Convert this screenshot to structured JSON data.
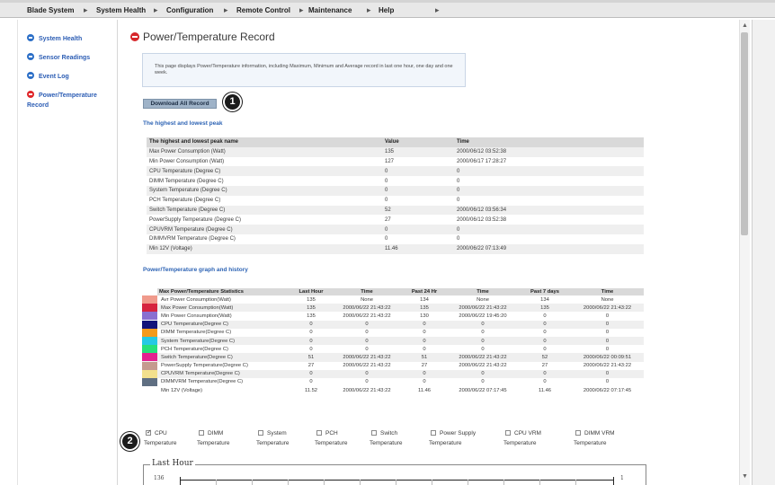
{
  "nav": {
    "items": [
      {
        "label": "Blade System",
        "x": 0
      },
      {
        "label": "System Health",
        "x": 0
      },
      {
        "label": "Configuration",
        "x": 0
      },
      {
        "label": "Remote Control",
        "x": 0
      },
      {
        "label": "Maintenance",
        "x": 0
      },
      {
        "label": "Help",
        "x": 0
      }
    ]
  },
  "sidebar": {
    "items": [
      {
        "label": "System Health"
      },
      {
        "label": "Sensor Readings"
      },
      {
        "label": "Event Log"
      },
      {
        "label": "Power/Temperature",
        "label_line2": "Record"
      }
    ]
  },
  "main": {
    "title": "Power/Temperature Record",
    "info_text": "This page displays Power/Temperature information, including Maximum, Minimum and Average record in last one hour, one day and one week.",
    "download_button": "Download All Record",
    "peak_section_title": "The highest and lowest peak",
    "peak_table": {
      "headers": [
        "The highest and lowest peak name",
        "Value",
        "Time"
      ],
      "rows": [
        [
          "Max Power Consumption (Watt)",
          "135",
          "2000/06/12 03:52:38"
        ],
        [
          "Min Power Consumption (Watt)",
          "127",
          "2000/06/17 17:28:27"
        ],
        [
          "CPU Temperature (Degree C)",
          "0",
          "0"
        ],
        [
          "DIMM Temperature (Degree C)",
          "0",
          "0"
        ],
        [
          "System Temperature (Degree C)",
          "0",
          "0"
        ],
        [
          "PCH Temperature (Degree C)",
          "0",
          "0"
        ],
        [
          "Switch Temperature (Degree C)",
          "52",
          "2000/06/12 03:56:34"
        ],
        [
          "PowerSupply Temperature (Degree C)",
          "27",
          "2000/06/12 03:52:38"
        ],
        [
          "CPUVRM Temperature (Degree C)",
          "0",
          "0"
        ],
        [
          "DIMMVRM Temperature (Degree C)",
          "0",
          "0"
        ],
        [
          "Min 12V (Voltage)",
          "11.46",
          "2000/06/22 07:13:49"
        ]
      ]
    },
    "graph_section_title": "Power/Temperature graph and history",
    "stats_table": {
      "headers": [
        "Max Power/Temperature Statistics",
        "Last Hour",
        "Time",
        "Past 24 Hr",
        "Time",
        "Past 7 days",
        "Time"
      ],
      "rows": [
        {
          "color": "#f09a8c",
          "cells": [
            "Avr Power Consumption(Watt)",
            "135",
            "None",
            "134",
            "None",
            "134",
            "None"
          ]
        },
        {
          "color": "#d6233f",
          "cells": [
            "Max Power Consumption(Watt)",
            "135",
            "2000/06/22 21:43:22",
            "135",
            "2000/06/22 21:43:22",
            "135",
            "2000/06/22 21:43:22"
          ]
        },
        {
          "color": "#8a6fd1",
          "cells": [
            "Min Power Consumption(Watt)",
            "135",
            "2000/06/22 21:43:22",
            "130",
            "2000/06/22 19:45:20",
            "0",
            "0"
          ]
        },
        {
          "color": "#13137a",
          "cells": [
            "CPU Temperature(Degree C)",
            "0",
            "0",
            "0",
            "0",
            "0",
            "0"
          ]
        },
        {
          "color": "#f49a1c",
          "cells": [
            "DIMM Temperature(Degree C)",
            "0",
            "0",
            "0",
            "0",
            "0",
            "0"
          ]
        },
        {
          "color": "#24c9e4",
          "cells": [
            "System Temperature(Degree C)",
            "0",
            "0",
            "0",
            "0",
            "0",
            "0"
          ]
        },
        {
          "color": "#26e07a",
          "cells": [
            "PCH Temperature(Degree C)",
            "0",
            "0",
            "0",
            "0",
            "0",
            "0"
          ]
        },
        {
          "color": "#e3228f",
          "cells": [
            "Switch Temperature(Degree C)",
            "51",
            "2000/06/22 21:43:22",
            "51",
            "2000/06/22 21:43:22",
            "52",
            "2000/06/22 00:09:51"
          ]
        },
        {
          "color": "#c59a8e",
          "cells": [
            "PowerSupply Temperature(Degree C)",
            "27",
            "2000/06/22 21:43:22",
            "27",
            "2000/06/22 21:43:22",
            "27",
            "2000/06/22 21:43:22"
          ]
        },
        {
          "color": "#f2e08d",
          "cells": [
            "CPUVRM Temperature(Degree C)",
            "0",
            "0",
            "0",
            "0",
            "0",
            "0"
          ]
        },
        {
          "color": "#5f6f82",
          "cells": [
            "DIMMVRM Temperature(Degree C)",
            "0",
            "0",
            "0",
            "0",
            "0",
            "0"
          ]
        },
        {
          "color": "",
          "cells": [
            "Min 12V (Voltage)",
            "11.52",
            "2000/06/22 21:43:22",
            "11.46",
            "2000/06/22 07:17:45",
            "11.46",
            "2000/06/22 07:17:45"
          ]
        }
      ]
    },
    "checkboxes": [
      {
        "label": "CPU",
        "label2": "Temperature",
        "checked": true
      },
      {
        "label": "DIMM",
        "label2": "Temperature",
        "checked": false
      },
      {
        "label": "System",
        "label2": "Temperature",
        "checked": false
      },
      {
        "label": "PCH",
        "label2": "Temperature",
        "checked": false
      },
      {
        "label": "Switch",
        "label2": "Temperature",
        "checked": false
      },
      {
        "label": "Power Supply",
        "label2": "Temperature",
        "checked": false
      },
      {
        "label": "CPU VRM",
        "label2": "Temperature",
        "checked": false
      },
      {
        "label": "DIMM VRM",
        "label2": "Temperature",
        "checked": false
      }
    ],
    "graph": {
      "legend": "Last Hour",
      "y_top_left": "136",
      "y_top_right": "1"
    }
  },
  "callouts": [
    "1",
    "2"
  ]
}
